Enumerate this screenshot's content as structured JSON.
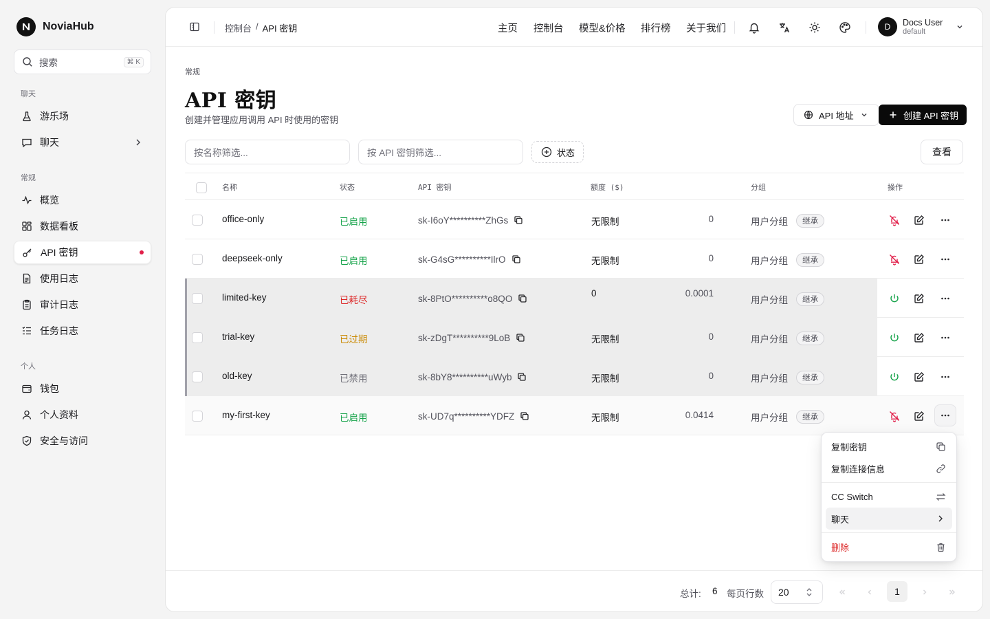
{
  "brand": {
    "name": "NoviaHub"
  },
  "search": {
    "placeholder": "搜索",
    "shortcut": "⌘ K"
  },
  "sidebar": {
    "sections": {
      "chat": "聊天",
      "general": "常规",
      "personal": "个人"
    },
    "items": [
      {
        "label": "游乐场",
        "icon": "flask-icon"
      },
      {
        "label": "聊天",
        "icon": "chat-icon"
      },
      {
        "label": "概览",
        "icon": "activity-icon"
      },
      {
        "label": "数据看板",
        "icon": "dashboard-icon"
      },
      {
        "label": "API 密钥",
        "icon": "key-icon",
        "active": true
      },
      {
        "label": "使用日志",
        "icon": "file-icon"
      },
      {
        "label": "审计日志",
        "icon": "clipboard-icon"
      },
      {
        "label": "任务日志",
        "icon": "list-icon"
      },
      {
        "label": "钱包",
        "icon": "wallet-icon"
      },
      {
        "label": "个人资料",
        "icon": "user-icon"
      },
      {
        "label": "安全与访问",
        "icon": "shield-icon"
      }
    ]
  },
  "topbar": {
    "breadcrumb": [
      "控制台",
      "API 密钥"
    ],
    "breadcrumb_sep": "/",
    "nav": [
      "主页",
      "控制台",
      "模型&价格",
      "排行榜",
      "关于我们"
    ],
    "user": {
      "initial": "D",
      "name": "Docs User",
      "group": "default"
    }
  },
  "page": {
    "eyebrow": "常规",
    "title": "API 密钥",
    "description": "创建并管理应用调用 API 时使用的密钥",
    "api_url_button": "API 地址",
    "create_button": "创建 API 密钥"
  },
  "filters": {
    "name_placeholder": "按名称筛选...",
    "key_placeholder": "按 API 密钥筛选...",
    "status_label": "状态",
    "view_label": "查看"
  },
  "table": {
    "headers": [
      "名称",
      "状态",
      "API 密钥",
      "额度 ($)",
      "分组",
      "操作"
    ],
    "rows": [
      {
        "name": "office-only",
        "status": "已启用",
        "status_color": "#16a34a",
        "key": "sk-I6oY**********ZhGs",
        "quota": "无限制",
        "used": "0",
        "group": "用户分组",
        "tag": "继承",
        "dim": false
      },
      {
        "name": "deepseek-only",
        "status": "已启用",
        "status_color": "#16a34a",
        "key": "sk-G4sG**********IlrO",
        "quota": "无限制",
        "used": "0",
        "group": "用户分组",
        "tag": "继承",
        "dim": false
      },
      {
        "name": "limited-key",
        "status": "已耗尽",
        "status_color": "#dc2626",
        "key": "sk-8PtO**********o8QO",
        "quota": "0",
        "used": "0.0001",
        "group": "用户分组",
        "tag": "继承",
        "dim": true
      },
      {
        "name": "trial-key",
        "status": "已过期",
        "status_color": "#ca8a04",
        "key": "sk-zDgT**********9LoB",
        "quota": "无限制",
        "used": "0",
        "group": "用户分组",
        "tag": "继承",
        "dim": true
      },
      {
        "name": "old-key",
        "status": "已禁用",
        "status_color": "#71717a",
        "key": "sk-8bY8**********uWyb",
        "quota": "无限制",
        "used": "0",
        "group": "用户分组",
        "tag": "继承",
        "dim": true
      },
      {
        "name": "my-first-key",
        "status": "已启用",
        "status_color": "#16a34a",
        "key": "sk-UD7q**********YDFZ",
        "quota": "无限制",
        "used": "0.0414",
        "group": "用户分组",
        "tag": "继承",
        "dim": false
      }
    ]
  },
  "pagination": {
    "total_label": "总计:",
    "total": "6",
    "rows_label": "每页行数",
    "page_size": "20",
    "current_page": "1"
  },
  "menu": {
    "copy_key": "复制密钥",
    "copy_conn": "复制连接信息",
    "cc_switch": "CC Switch",
    "chat": "聊天",
    "delete": "删除"
  },
  "colors": {
    "enabled": "#16a34a",
    "exhausted": "#dc2626",
    "expired": "#ca8a04",
    "disabled": "#71717a",
    "danger_icon": "#e11d48",
    "power_icon": "#16a34a"
  }
}
